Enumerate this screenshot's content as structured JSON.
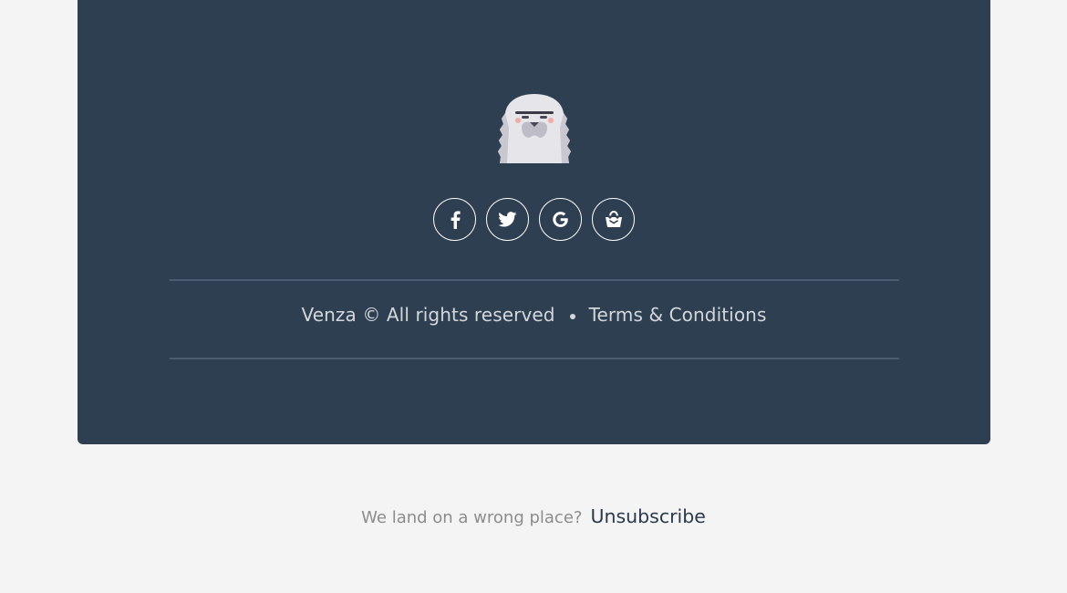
{
  "footer": {
    "brand_copyright": "Venza © All rights reserved",
    "terms_label": "Terms & Conditions",
    "background_color": "#2f3f52",
    "social_links": [
      {
        "icon": "facebook-icon",
        "name": "facebook"
      },
      {
        "icon": "twitter-icon",
        "name": "twitter"
      },
      {
        "icon": "google-icon",
        "name": "google"
      },
      {
        "icon": "shopping-basket-icon",
        "name": "shop"
      }
    ],
    "logo": {
      "icon": "yeti-mascot-icon"
    }
  },
  "unsubscribe": {
    "question": "We land on a wrong place?",
    "link_label": "Unsubscribe"
  },
  "colors": {
    "page_background": "#f4f4f4",
    "footer_text": "#d3d7dc",
    "link_dark": "#2b394a"
  }
}
